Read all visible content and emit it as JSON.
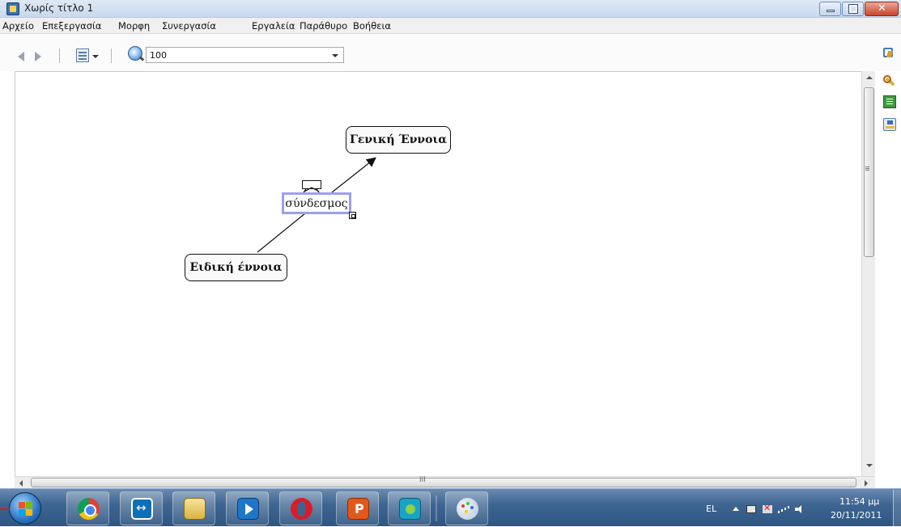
{
  "window": {
    "title": "Χωρίς τίτλο 1"
  },
  "menu": {
    "items": [
      "Αρχείο",
      "Επεξεργασία",
      "Μορφη",
      "Συνεργασία",
      "Εργαλεία",
      "Παράθυρο",
      "Βοήθεια"
    ]
  },
  "toolbar": {
    "zoom_value": "100"
  },
  "map": {
    "concept_general": "Γενική Έννοια",
    "concept_specific": "Ειδική έννοια",
    "link_phrase": "σύνδεσμος"
  },
  "scroll": {
    "h_grip": "III"
  },
  "taskbar": {
    "apps": [
      "chrome-icon",
      "teamviewer-icon",
      "explorer-icon",
      "media-player-icon",
      "opera-icon",
      "powerpoint-icon",
      "cmaptools-icon",
      "paint-icon"
    ]
  },
  "tray": {
    "language": "EL",
    "time": "11:54 μμ",
    "date": "20/11/2011"
  },
  "colors": {
    "link_selection_border": "#9b9ff0",
    "taskbar": "#3f6691"
  }
}
